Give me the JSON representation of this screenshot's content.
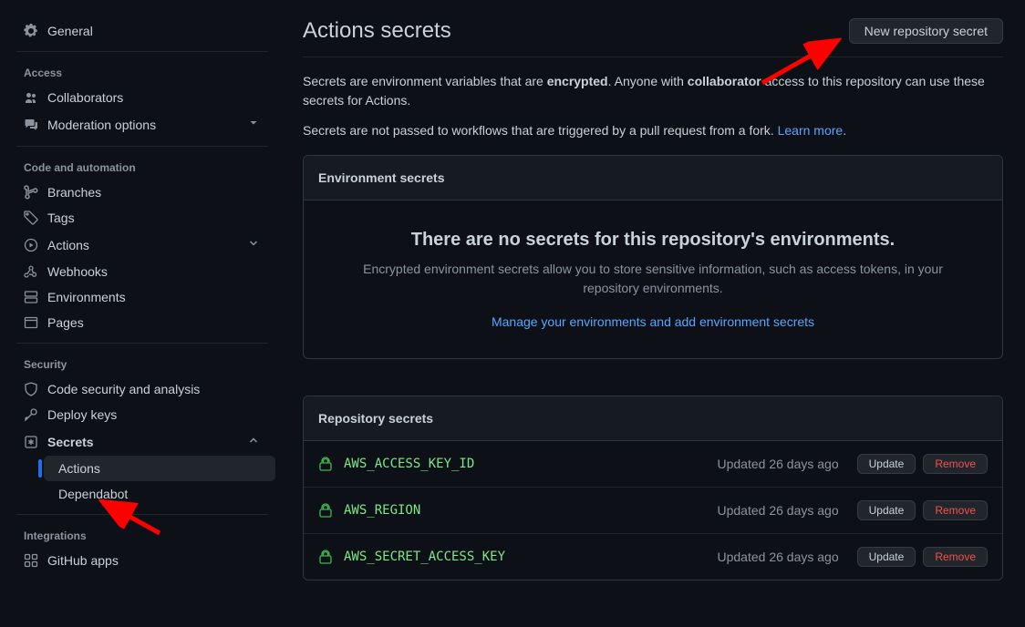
{
  "sidebar": {
    "general": "General",
    "sections": {
      "access": {
        "label": "Access",
        "items": [
          {
            "icon": "people",
            "label": "Collaborators"
          },
          {
            "icon": "comment",
            "label": "Moderation options",
            "chev": true
          }
        ]
      },
      "code": {
        "label": "Code and automation",
        "items": [
          {
            "icon": "branch",
            "label": "Branches"
          },
          {
            "icon": "tag",
            "label": "Tags"
          },
          {
            "icon": "play",
            "label": "Actions",
            "chev": true
          },
          {
            "icon": "webhook",
            "label": "Webhooks"
          },
          {
            "icon": "env",
            "label": "Environments"
          },
          {
            "icon": "pages",
            "label": "Pages"
          }
        ]
      },
      "security": {
        "label": "Security",
        "items": [
          {
            "icon": "shield",
            "label": "Code security and analysis"
          },
          {
            "icon": "key",
            "label": "Deploy keys"
          },
          {
            "icon": "secret",
            "label": "Secrets",
            "chev": "up",
            "bold": true
          }
        ],
        "sub": [
          {
            "label": "Actions",
            "active": true
          },
          {
            "label": "Dependabot"
          }
        ]
      },
      "integrations": {
        "label": "Integrations",
        "items": [
          {
            "icon": "apps",
            "label": "GitHub apps"
          }
        ]
      }
    }
  },
  "page": {
    "title": "Actions secrets",
    "new_button": "New repository secret",
    "desc1_a": "Secrets are environment variables that are ",
    "desc1_b_bold": "encrypted",
    "desc1_c": ". Anyone with ",
    "desc1_d_bold": "collaborator",
    "desc1_e": " access to this repository can use these secrets for Actions.",
    "desc2_a": "Secrets are not passed to workflows that are triggered by a pull request from a fork. ",
    "desc2_link": "Learn more",
    "desc2_b": "."
  },
  "env_panel": {
    "header": "Environment secrets",
    "empty_title": "There are no secrets for this repository's environments.",
    "empty_desc": "Encrypted environment secrets allow you to store sensitive information, such as access tokens, in your repository environments.",
    "link": "Manage your environments and add environment secrets"
  },
  "repo_panel": {
    "header": "Repository secrets",
    "update_label": "Update",
    "remove_label": "Remove",
    "secrets": [
      {
        "name": "AWS_ACCESS_KEY_ID",
        "meta": "Updated 26 days ago"
      },
      {
        "name": "AWS_REGION",
        "meta": "Updated 26 days ago"
      },
      {
        "name": "AWS_SECRET_ACCESS_KEY",
        "meta": "Updated 26 days ago"
      }
    ]
  }
}
